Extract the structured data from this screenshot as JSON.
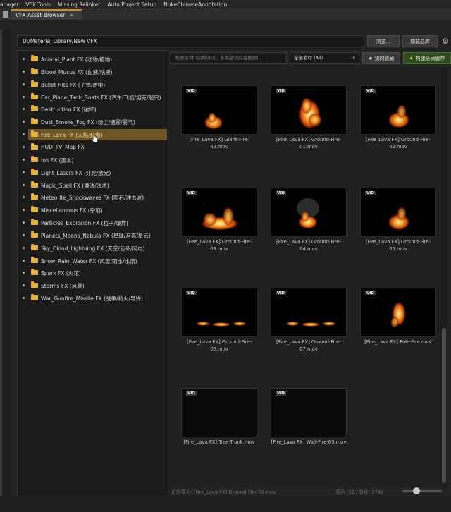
{
  "menu": [
    "anager",
    "VFX Tools",
    "Missing Relinker",
    "Auto Project Setup",
    "NukeChineseAnnotation"
  ],
  "tab": {
    "title": "VFX Asset Browser",
    "close": "×"
  },
  "path": {
    "value": "D:/Material Library/New VFX",
    "browse_label": "浏览...",
    "load_label": "加载总库"
  },
  "tree": {
    "items": [
      "Animal_Plant FX (动物/植物)",
      "Blood_Mucus FX (血液/粘液)",
      "Bullet Hits FX (子弹/击中)",
      "Car_Plane_Tank_Boats FX (汽车/飞机/坦克/船只)",
      "Destruction FX (破坏)",
      "Dust_Smoke_Fog FX (粉尘/烟雾/雾气)",
      "Fire_Lava FX (火焰/熔岩)",
      "HUD_TV_Map FX",
      "Ink FX (墨水)",
      "Light_Lasers FX (灯光/激光)",
      "Magic_Spell FX (魔法/法术)",
      "Meteorite_Shockwaves FX (陨石/冲击波)",
      "Miscellaneous FX (杂项)",
      "Particles_Explosion FX (粒子/爆炸)",
      "Planets_Moons_Nebula FX (星球/月亮/星云)",
      "Sky_Cloud_Lightning FX (天空/云朵/闪电)",
      "Snow_Rain_Water FX (风雪/雨水/水流)",
      "Spark FX (火花)",
      "Storms FX (风暴)",
      "War_Gunfire_Missile FX (战争/枪火/导弹)"
    ],
    "selected_index": 6
  },
  "search": {
    "placeholder": "检索素材 (空格分词，多关键词综合搜索)..."
  },
  "filter": {
    "value": "全部素材 (All)"
  },
  "favorites_label": "★ 我的收藏",
  "build_label": "构建全局缓存",
  "grid": {
    "badge": "VID",
    "cards": [
      {
        "name": "[Fire_Lava FX] Giant-Fire-02.mov",
        "fire": "small"
      },
      {
        "name": "[Fire_Lava FX] Ground-Fire-01.mov",
        "fire": "tall"
      },
      {
        "name": "[Fire_Lava FX] Ground-Fire-02.mov",
        "fire": "medium"
      },
      {
        "name": "[Fire_Lava FX] Ground-Fire-03.mov",
        "fire": "wide"
      },
      {
        "name": "[Fire_Lava FX] Ground-Fire-04.mov",
        "fire": "smoke"
      },
      {
        "name": "[Fire_Lava FX] Ground-Fire-05.mov",
        "fire": "medium"
      },
      {
        "name": "[Fire_Lava FX] Ground-Fire-06.mov",
        "fire": "line"
      },
      {
        "name": "[Fire_Lava FX] Ground-Fire-07.mov",
        "fire": "line"
      },
      {
        "name": "[Fire_Lava FX] Pole-Fire.mov",
        "fire": "pole"
      },
      {
        "name": "[Fire_Lava FX] Tree-Trunk.mov",
        "fire": "none"
      },
      {
        "name": "[Fire_Lava FX] Wall-Fire-03.mov",
        "fire": "none"
      }
    ]
  },
  "status": {
    "left": "正在导入: [Fire_Lava FX] Ground-Fire-04.mov",
    "right": "显示: 32 / 总计: 2744"
  },
  "zoom": {
    "value": 0.35
  },
  "colors": {
    "accent": "#d4891c",
    "selection": "#6f5626",
    "folder": "#e3b24a",
    "build_button": "#2f4a1f"
  }
}
